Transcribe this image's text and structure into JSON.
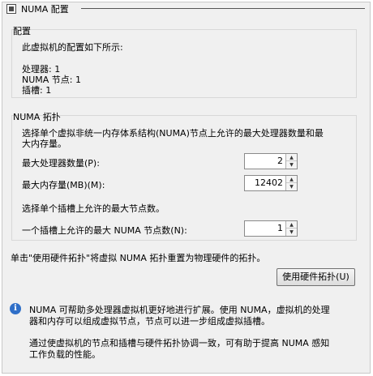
{
  "header": {
    "title": "NUMA 配置",
    "icon": "numa-node-icon"
  },
  "config_group": {
    "title": "配置",
    "intro": "此虚拟机的配置如下所示:",
    "processors": "处理器: 1",
    "numa_nodes": "NUMA 节点: 1",
    "sockets": "插槽: 1"
  },
  "topology_group": {
    "title": "NUMA 拓扑",
    "desc_line1": "选择单个虚拟非统一内存体系结构(NUMA)节点上允许的最大处理器数量和最",
    "desc_line2": "大内存量。",
    "max_processors_label": "最大处理器数量(P):",
    "max_processors_value": "2",
    "max_memory_label": "最大内存量(MB)(M):",
    "max_memory_value": "12402",
    "socket_desc": "选择单个插槽上允许的最大节点数。",
    "max_nodes_label": "一个插槽上允许的最大 NUMA 节点数(N):",
    "max_nodes_value": "1"
  },
  "hardware_topology": {
    "description": "单击\"使用硬件拓扑\"将虚拟 NUMA 拓扑重置为物理硬件的拓扑。",
    "button_label": "使用硬件拓扑(U)"
  },
  "info": {
    "icon": "info-icon",
    "para1_line1": "NUMA 可帮助多处理器虚拟机更好地进行扩展。使用 NUMA，虚拟机的处理",
    "para1_line2": "器和内存可以组成虚拟节点，节点可以进一步组成虚拟插槽。",
    "para2_line1": "通过使虚拟机的节点和插槽与硬件拓扑协调一致，可有助于提高 NUMA 感知",
    "para2_line2": "工作负载的性能。"
  },
  "spinner_glyphs": {
    "up": "▲",
    "down": "▼"
  }
}
